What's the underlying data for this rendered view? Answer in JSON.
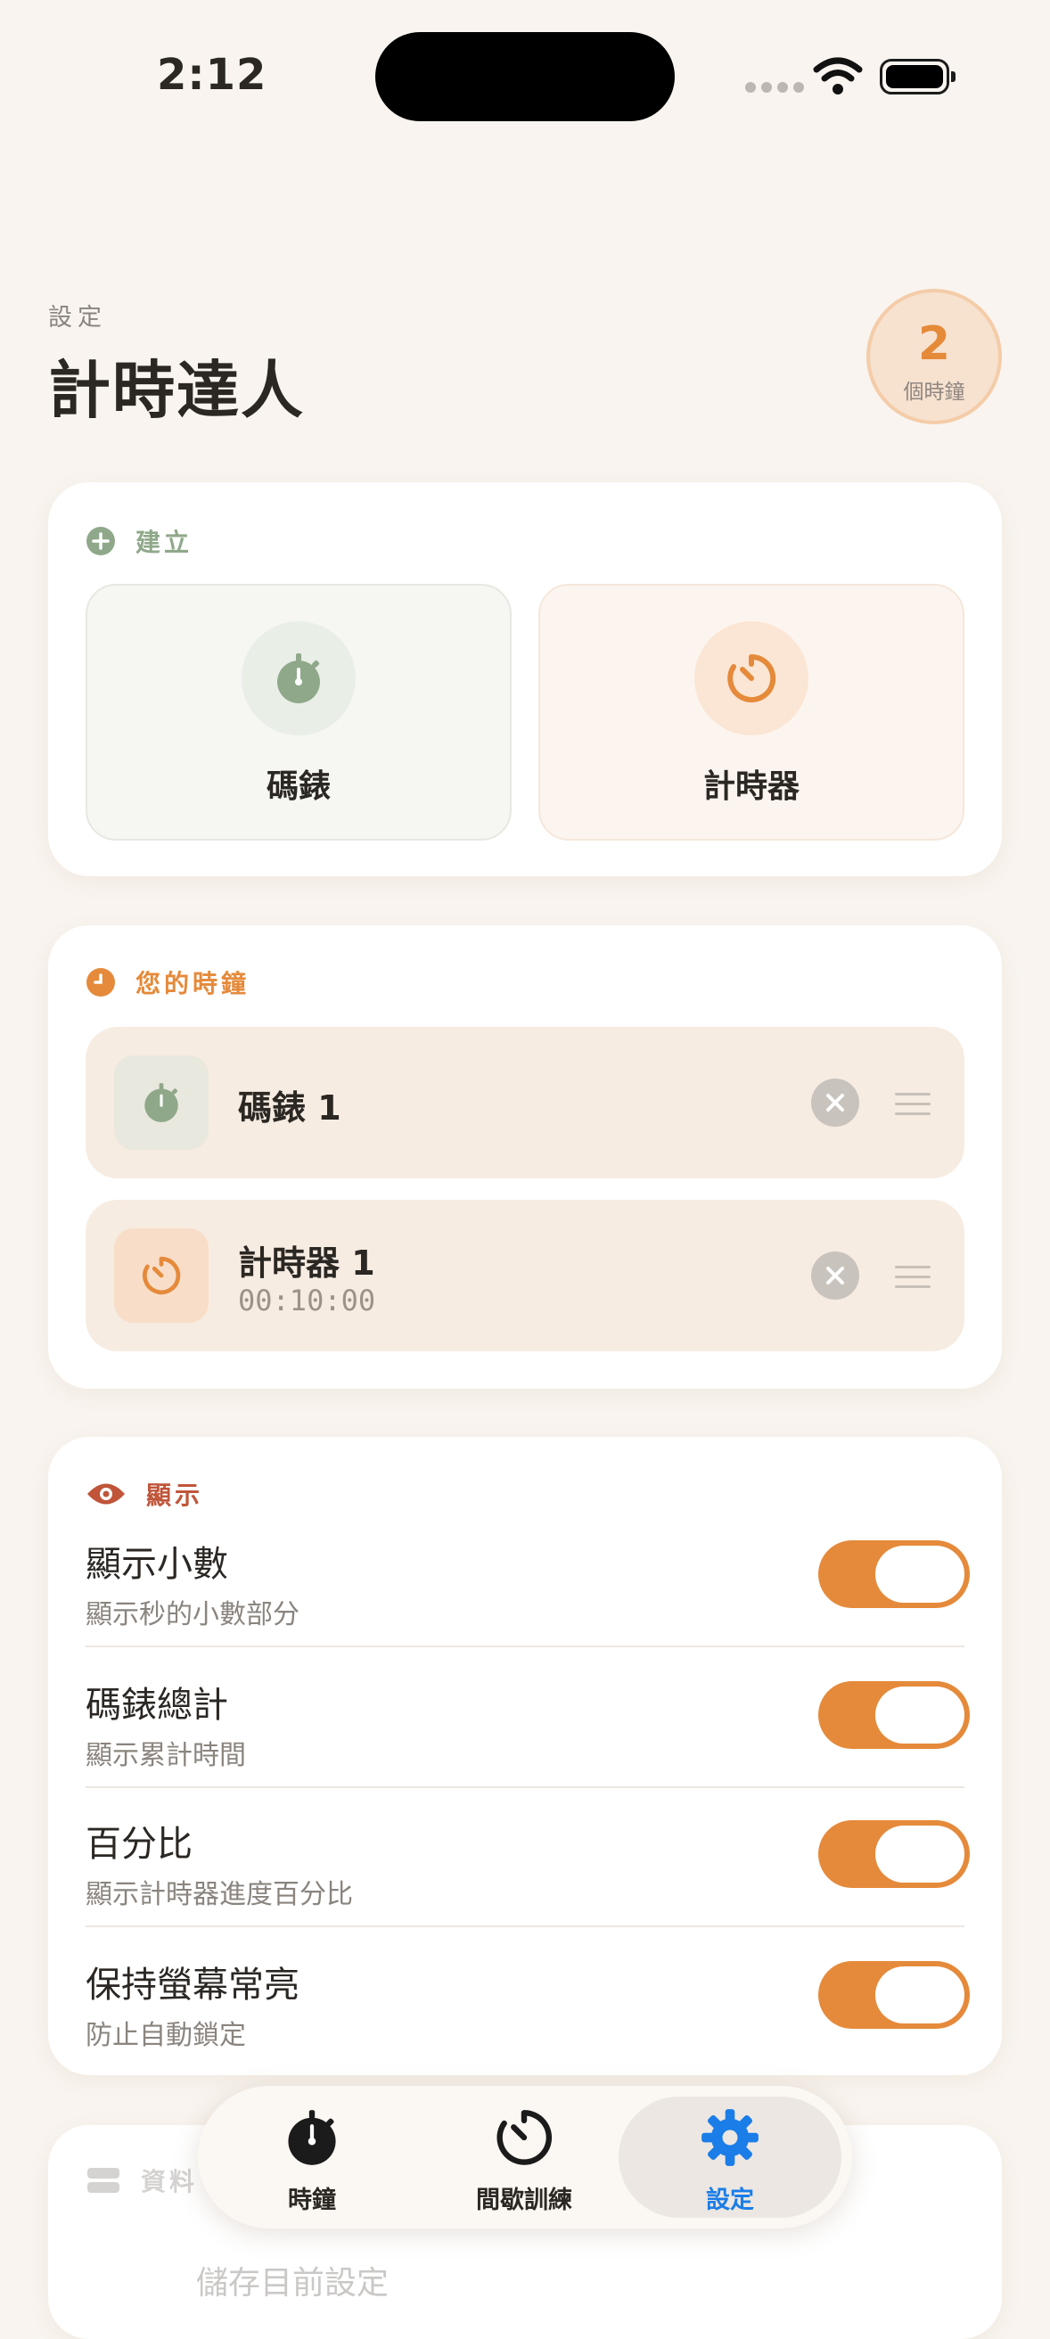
{
  "status": {
    "time": "2:12"
  },
  "header": {
    "eyebrow": "設定",
    "title": "計時達人",
    "count": "2",
    "count_label": "個時鐘"
  },
  "create": {
    "heading": "建立",
    "stopwatch_label": "碼錶",
    "timer_label": "計時器"
  },
  "clocks": {
    "heading": "您的時鐘",
    "items": [
      {
        "name": "碼錶 1",
        "sub": ""
      },
      {
        "name": "計時器 1",
        "sub": "00:10:00"
      }
    ]
  },
  "display": {
    "heading": "顯示",
    "settings": [
      {
        "title": "顯示小數",
        "sub": "顯示秒的小數部分",
        "on": true
      },
      {
        "title": "碼錶總計",
        "sub": "顯示累計時間",
        "on": true
      },
      {
        "title": "百分比",
        "sub": "顯示計時器進度百分比",
        "on": true
      },
      {
        "title": "保持螢幕常亮",
        "sub": "防止自動鎖定",
        "on": true
      }
    ]
  },
  "data_section": {
    "heading": "資料",
    "first_item": "儲存目前設定"
  },
  "tabs": [
    {
      "label": "時鐘",
      "active": false
    },
    {
      "label": "間歇訓練",
      "active": false
    },
    {
      "label": "設定",
      "active": true
    }
  ],
  "colors": {
    "accent": "#e58a3b",
    "sage": "#8fa88a",
    "display_red": "#c0553a",
    "tab_active": "#1a7de8",
    "background": "#f9f4ef"
  }
}
